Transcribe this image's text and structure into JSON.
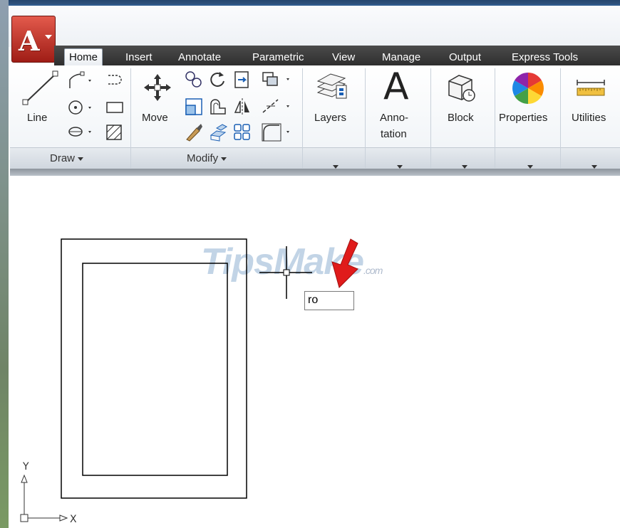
{
  "ribbon": {
    "tabs": [
      {
        "label": "Home",
        "active": true
      },
      {
        "label": "Insert"
      },
      {
        "label": "Annotate"
      },
      {
        "label": "Parametric"
      },
      {
        "label": "View"
      },
      {
        "label": "Manage"
      },
      {
        "label": "Output"
      },
      {
        "label": "Express Tools"
      }
    ],
    "draw": {
      "title": "Draw",
      "line_label": "Line"
    },
    "modify": {
      "title": "Modify",
      "move_label": "Move"
    },
    "layers_label": "Layers",
    "annotation_label_1": "Anno-",
    "annotation_label_2": "tation",
    "block_label": "Block",
    "properties_label": "Properties",
    "utilities_label": "Utilities"
  },
  "canvas": {
    "command_input_value": "ro",
    "watermark_main": "TipsMake",
    "watermark_suffix": ".com",
    "ucs_x_label": "X",
    "ucs_y_label": "Y"
  },
  "colors": {
    "app_button": "#c0392b",
    "tab_strip": "#3a3a3a",
    "cursor_arrow": "#e01b1b"
  },
  "icons": [
    "autocad-logo-icon",
    "line-icon",
    "polyline-icon",
    "circle-icon",
    "arc-icon",
    "rectangle-icon",
    "hatch-icon",
    "move-icon",
    "rotate-icon",
    "trim-icon",
    "copy-icon",
    "mirror-icon",
    "fillet-icon",
    "stretch-icon",
    "scale-icon",
    "array-icon",
    "layers-icon",
    "annotation-icon",
    "block-icon",
    "properties-icon",
    "utilities-icon",
    "crosshair-icon",
    "red-arrow-icon",
    "ucs-icon"
  ]
}
